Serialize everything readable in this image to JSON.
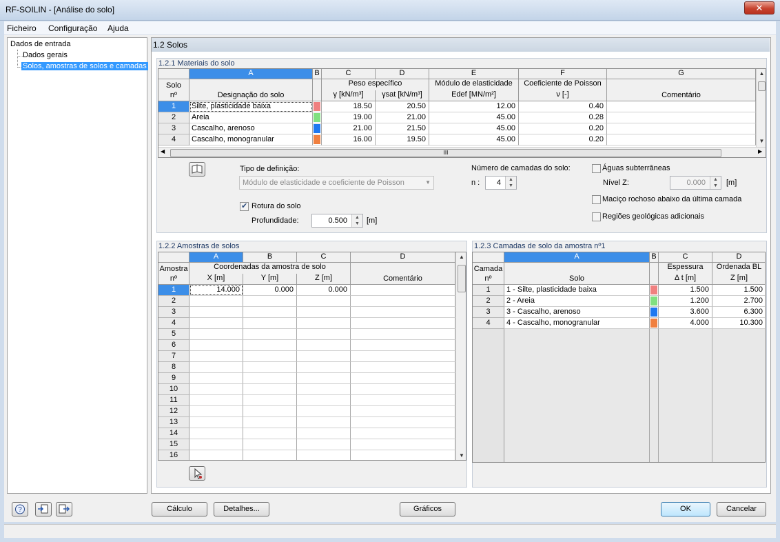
{
  "window": {
    "title": "RF-SOILIN - [Análise do solo]",
    "close": "✕"
  },
  "menu": [
    "Ficheiro",
    "Configuração",
    "Ajuda"
  ],
  "tree": {
    "root": "Dados de entrada",
    "items": [
      "Dados gerais",
      "Solos, amostras de solos e camadas"
    ]
  },
  "section_title": "1.2 Solos",
  "materials": {
    "title": "1.2.1 Materiais do solo",
    "col_letters": [
      "A",
      "B",
      "C",
      "D",
      "E",
      "F",
      "G"
    ],
    "row_header": [
      "Solo",
      "nº"
    ],
    "hdr_A": "Designação do solo",
    "hdr_CD_top": "Peso específico",
    "hdr_C": "γ [kN/m³]",
    "hdr_D": "γsat [kN/m³]",
    "hdr_E_top": "Módulo de elasticidade",
    "hdr_E": "Edef [MN/m²]",
    "hdr_F_top": "Coeficiente de Poisson",
    "hdr_F": "ν [-]",
    "hdr_G": "Comentário",
    "rows": [
      {
        "no": "1",
        "name": "Silte, plasticidade baixa",
        "color": "#f08080",
        "gamma": "18.50",
        "gsat": "20.50",
        "edef": "12.00",
        "nu": "0.40"
      },
      {
        "no": "2",
        "name": "Areia",
        "color": "#80e080",
        "gamma": "19.00",
        "gsat": "21.00",
        "edef": "45.00",
        "nu": "0.28"
      },
      {
        "no": "3",
        "name": "Cascalho, arenoso",
        "color": "#1e78f0",
        "gamma": "21.00",
        "gsat": "21.50",
        "edef": "45.00",
        "nu": "0.20"
      },
      {
        "no": "4",
        "name": "Cascalho, monogranular",
        "color": "#f08040",
        "gamma": "16.00",
        "gsat": "19.50",
        "edef": "45.00",
        "nu": "0.20"
      }
    ],
    "hscroll_mark": "III"
  },
  "options": {
    "def_type_label": "Tipo de definição:",
    "def_type_value": "Módulo de elasticidade e coeficiente de Poisson",
    "failure_label": "Rotura do solo",
    "failure_checked": true,
    "depth_label": "Profundidade:",
    "depth_value": "0.500",
    "depth_unit": "[m]",
    "layers_label": "Número de camadas do solo:",
    "n_label": "n :",
    "n_value": "4",
    "groundwater_label": "Águas subterrâneas",
    "levelz_label": "Nível Z:",
    "levelz_value": "0.000",
    "levelz_unit": "[m]",
    "rock_label": "Maciço rochoso abaixo da última camada",
    "geo_label": "Regiões geológicas adicionais"
  },
  "samples": {
    "title": "1.2.2 Amostras de solos",
    "col_letters": [
      "A",
      "B",
      "C",
      "D"
    ],
    "row_header": [
      "Amostra",
      "nº"
    ],
    "coord_header": "Coordenadas da amostra de solo",
    "hdr_X": "X [m]",
    "hdr_Y": "Y [m]",
    "hdr_Z": "Z [m]",
    "hdr_comment": "Comentário",
    "rows": [
      {
        "no": "1",
        "x": "14.000",
        "y": "0.000",
        "z": "0.000"
      },
      {
        "no": "2"
      },
      {
        "no": "3"
      },
      {
        "no": "4"
      },
      {
        "no": "5"
      },
      {
        "no": "6"
      },
      {
        "no": "7"
      },
      {
        "no": "8"
      },
      {
        "no": "9"
      },
      {
        "no": "10"
      },
      {
        "no": "11"
      },
      {
        "no": "12"
      },
      {
        "no": "13"
      },
      {
        "no": "14"
      },
      {
        "no": "15"
      },
      {
        "no": "16"
      }
    ]
  },
  "layers": {
    "title": "1.2.3 Camadas de solo da amostra nº1",
    "col_letters": [
      "A",
      "B",
      "C",
      "D"
    ],
    "row_header": [
      "Camada",
      "nº"
    ],
    "hdr_A": "Solo",
    "hdr_C_top": "Espessura",
    "hdr_C": "Δ t [m]",
    "hdr_D_top": "Ordenada BL",
    "hdr_D": "Z [m]",
    "rows": [
      {
        "no": "1",
        "soil": "1 - Silte, plasticidade baixa",
        "color": "#f08080",
        "thick": "1.500",
        "z": "1.500"
      },
      {
        "no": "2",
        "soil": "2 - Areia",
        "color": "#80e080",
        "thick": "1.200",
        "z": "2.700"
      },
      {
        "no": "3",
        "soil": "3 - Cascalho, arenoso",
        "color": "#1e78f0",
        "thick": "3.600",
        "z": "6.300"
      },
      {
        "no": "4",
        "soil": "4 - Cascalho, monogranular",
        "color": "#f08040",
        "thick": "4.000",
        "z": "10.300"
      }
    ]
  },
  "buttons": {
    "calc": "Cálculo",
    "details": "Detalhes...",
    "graphics": "Gráficos",
    "ok": "OK",
    "cancel": "Cancelar"
  }
}
